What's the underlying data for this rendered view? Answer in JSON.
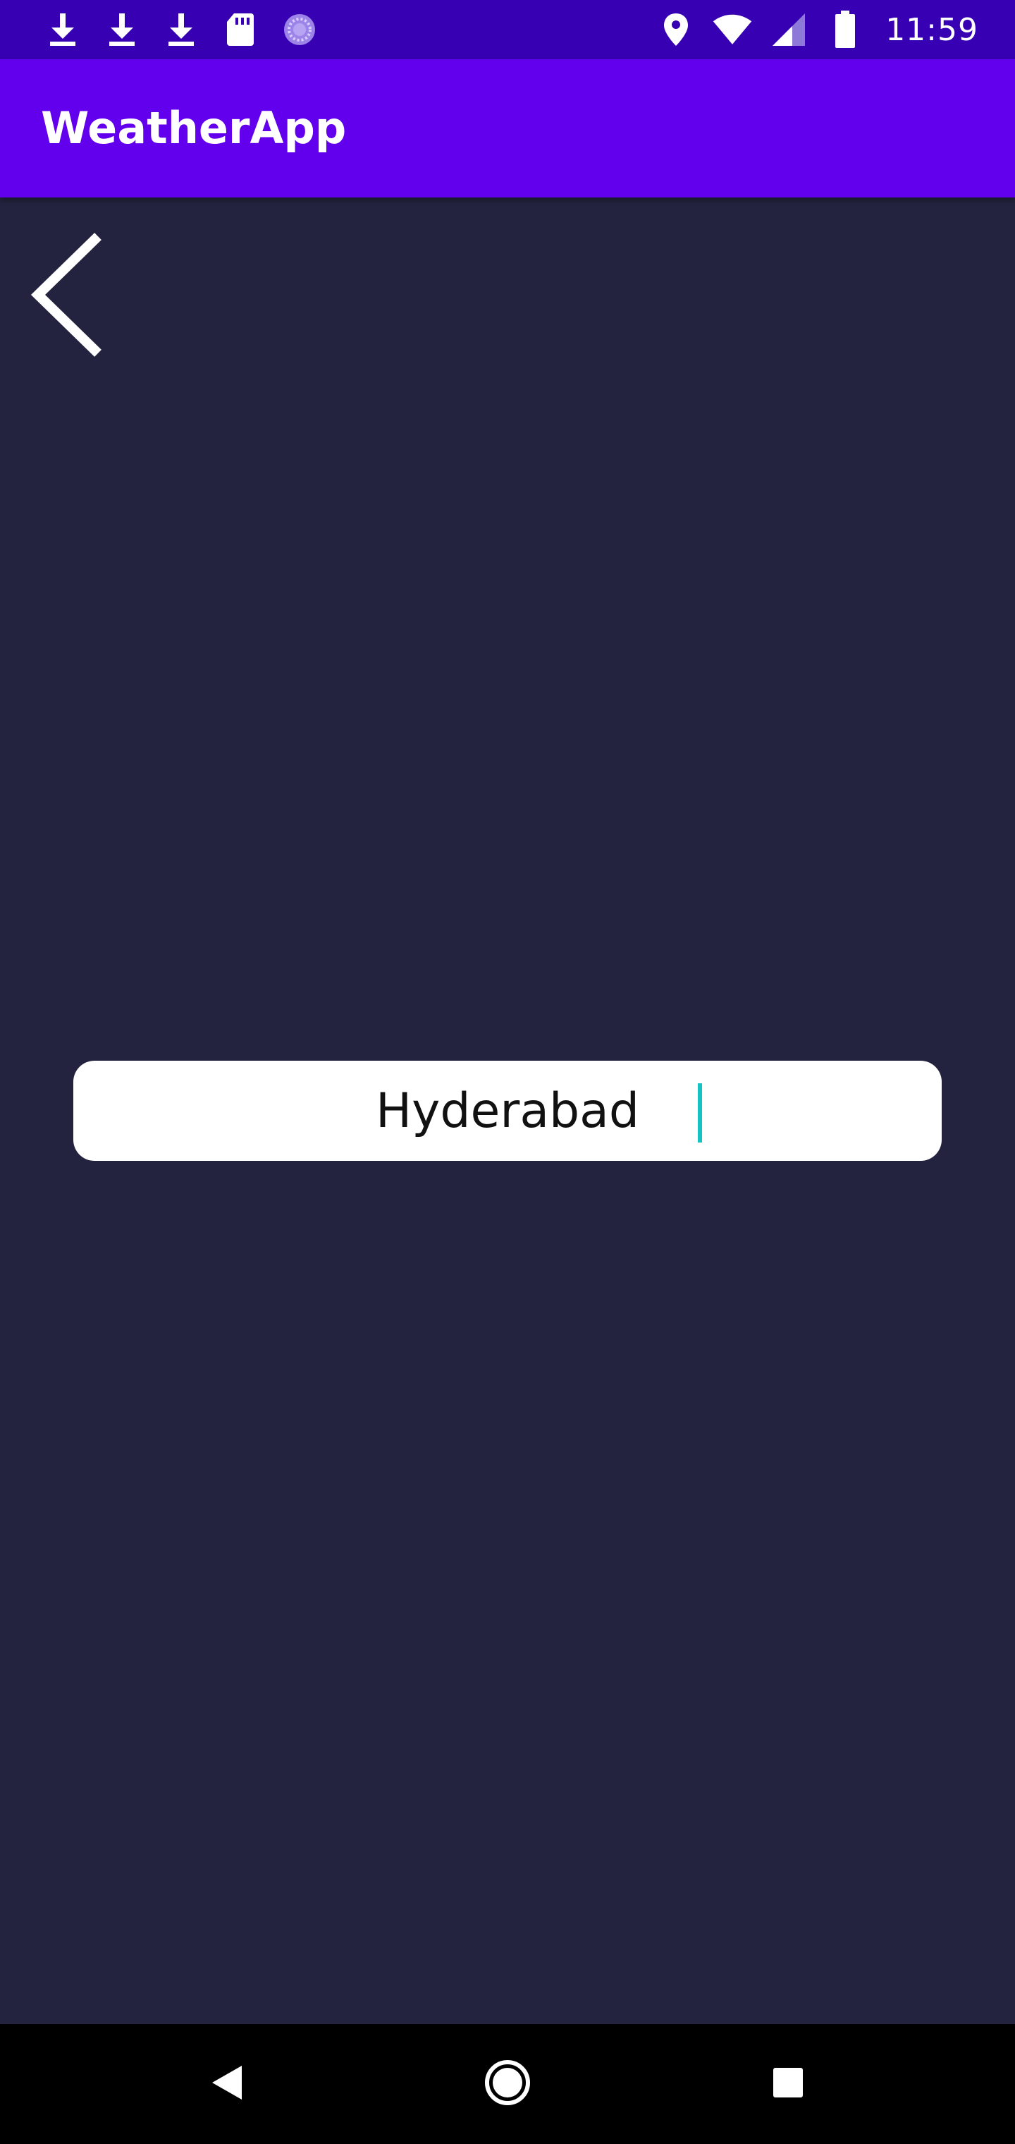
{
  "status_bar": {
    "time": "11:59",
    "left_icons": [
      "download-icon",
      "download-icon",
      "download-icon",
      "sd-card-icon",
      "sync-progress-icon"
    ],
    "right_icons": [
      "location-icon",
      "wifi-icon",
      "cell-signal-icon",
      "battery-icon"
    ]
  },
  "app_bar": {
    "title": "WeatherApp"
  },
  "search": {
    "value": "Hyderabad",
    "placeholder": ""
  },
  "nav_bar": {
    "icons": [
      "nav-back-icon",
      "nav-home-icon",
      "nav-recents-icon"
    ]
  },
  "colors": {
    "status_bar": "#3700b3",
    "app_bar": "#6200ee",
    "background": "#23233f",
    "caret": "#16c2c2",
    "nav_bar": "#000000"
  }
}
